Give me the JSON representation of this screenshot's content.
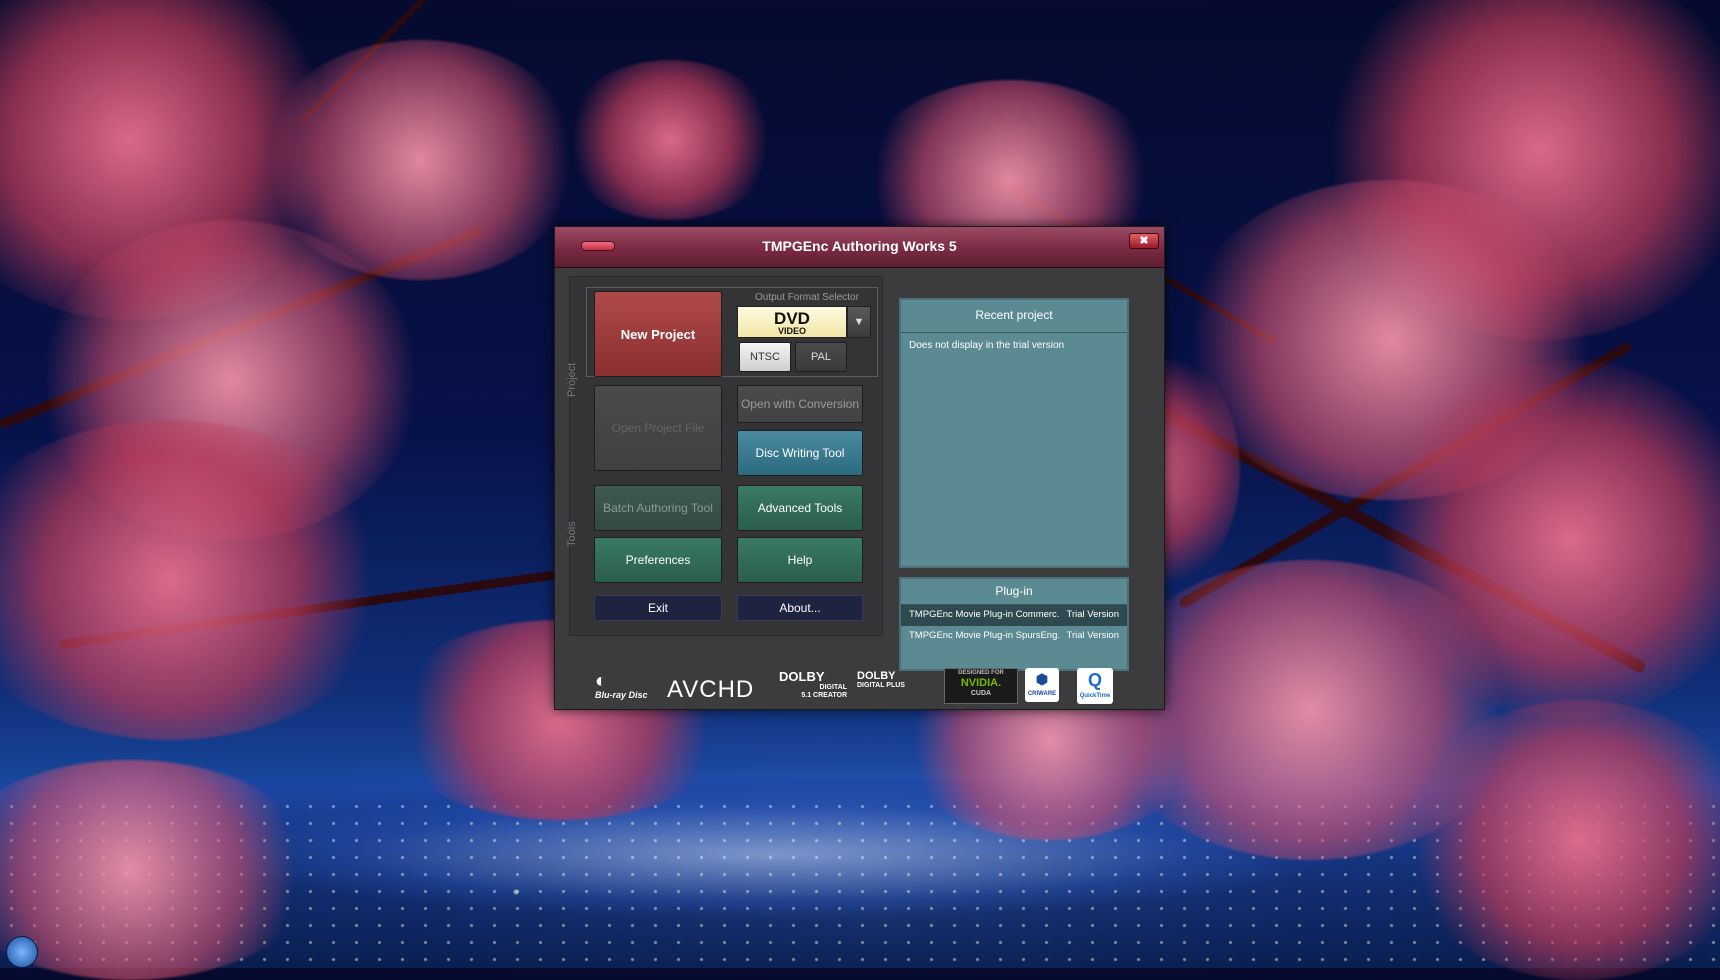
{
  "window": {
    "title": "TMPGEnc Authoring Works 5",
    "close_glyph": "✖"
  },
  "project_section": {
    "label": "Project",
    "new_project": "New Project",
    "output_format_label": "Output Format Selector",
    "format": {
      "main": "DVD",
      "sub": "VIDEO"
    },
    "dropdown_icon": "chevron-down-icon",
    "ntsc": "NTSC",
    "pal": "PAL",
    "open_project_file": "Open Project File",
    "open_with_conversion": "Open with Conversion",
    "disc_writing_tool": "Disc Writing Tool"
  },
  "tools_section": {
    "label": "Tools",
    "batch_authoring_tool": "Batch Authoring Tool",
    "advanced_tools": "Advanced Tools",
    "preferences": "Preferences",
    "help": "Help",
    "exit": "Exit",
    "about": "About..."
  },
  "recent_project": {
    "title": "Recent project",
    "message": "Does not display in the trial version"
  },
  "plugin": {
    "title": "Plug-in",
    "items": [
      {
        "name": "TMPGEnc Movie Plug-in Commerc...",
        "status": "Trial Version"
      },
      {
        "name": "TMPGEnc Movie Plug-in SpursEng...",
        "status": "Trial Version"
      }
    ]
  },
  "logos": {
    "bluray_main": "Blu-ray Disc",
    "avchd": "AVCHD",
    "dolby1_main": "DOLBY",
    "dolby1_sub": "DIGITAL",
    "dolby1_sub2": "5.1 CREATOR",
    "dolby2_main": "DOLBY",
    "dolby2_sub": "DIGITAL PLUS",
    "nvidia_top": "DESIGNED FOR",
    "nvidia_main": "NVIDIA.",
    "nvidia_sub": "CUDA",
    "cri": "CRIWARE",
    "quicktime": "QuickTime"
  },
  "colors": {
    "titlebar": "#7a2a42",
    "new_project": "#9a3c3e",
    "disc_tool": "#3a7a90",
    "tools_green": "#2f6a56",
    "panel_teal": "#5c8a92"
  }
}
